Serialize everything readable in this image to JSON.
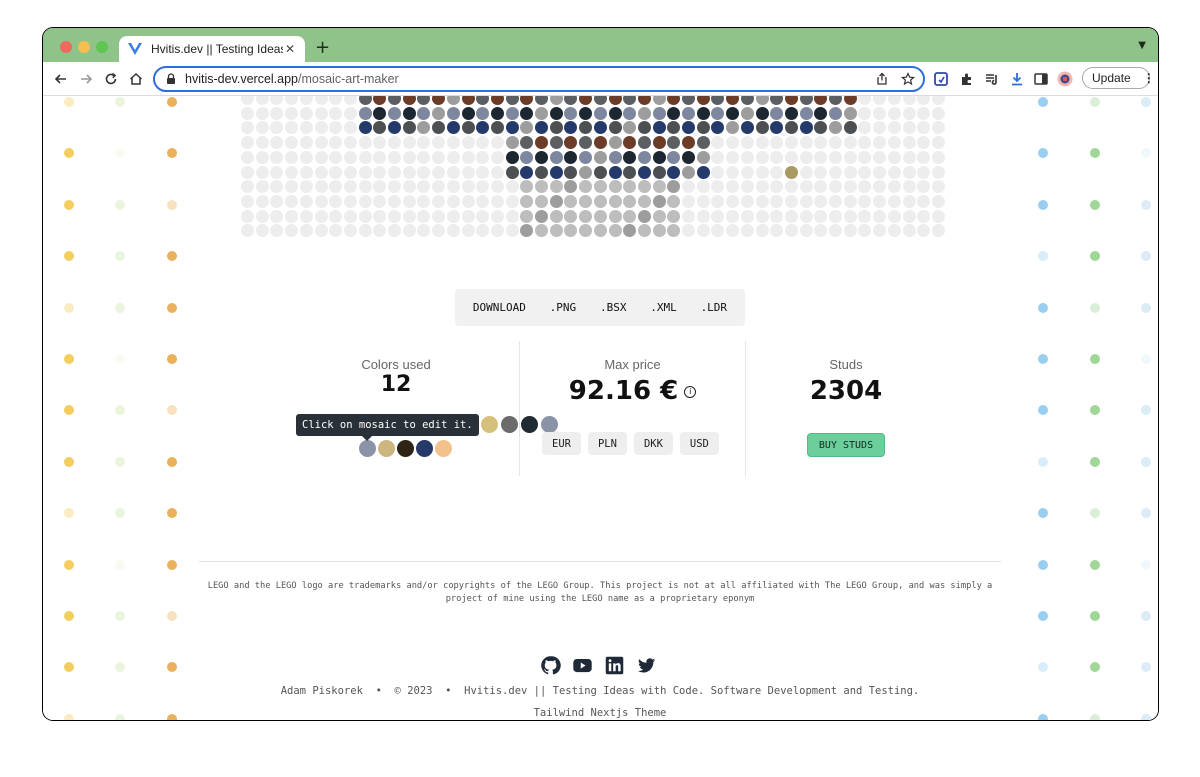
{
  "browser": {
    "tab_title": "Hvitis.dev || Testing Ideas with",
    "url_host": "hvitis-dev.vercel.app",
    "url_path": "/mosaic-art-maker",
    "update_label": "Update"
  },
  "download": {
    "buttons": [
      "DOWNLOAD",
      ".PNG",
      ".BSX",
      ".XML",
      ".LDR"
    ]
  },
  "stats": {
    "colors_used_label": "Colors used",
    "colors_used_value": "12",
    "max_price_label": "Max price",
    "max_price_value": "92.16 €",
    "studs_label": "Studs",
    "studs_value": "2304",
    "tooltip": "Click on mosaic to edit it.",
    "currencies": [
      "EUR",
      "PLN",
      "DKK",
      "USD"
    ],
    "buy_label": "BUY STUDS",
    "color_swatches": [
      "#d6c17c",
      "#6b6b6b",
      "#202a33",
      "#8a93a8",
      "#ccb57f",
      "#2e2416",
      "#253a68",
      "#f3c28c"
    ]
  },
  "footer": {
    "legal": "LEGO and the LEGO logo are trademarks and/or copyrights of the LEGO Group. This project is not at all affiliated with The LEGO Group, and was simply a project of mine using the LEGO name as a proprietary eponym",
    "author": "Adam Piskorek",
    "sep": "•",
    "year": "© 2023",
    "site": "Hvitis.dev || Testing Ideas with Code. Software Development and Testing.",
    "theme": "Tailwind Nextjs Theme",
    "social_icons": [
      "github-icon",
      "youtube-icon",
      "linkedin-icon",
      "twitter-icon"
    ]
  },
  "colors": {
    "tabbar": "#90c38a",
    "accent_blue": "#2f6ed8",
    "buy_green": "#6ccf9b"
  }
}
